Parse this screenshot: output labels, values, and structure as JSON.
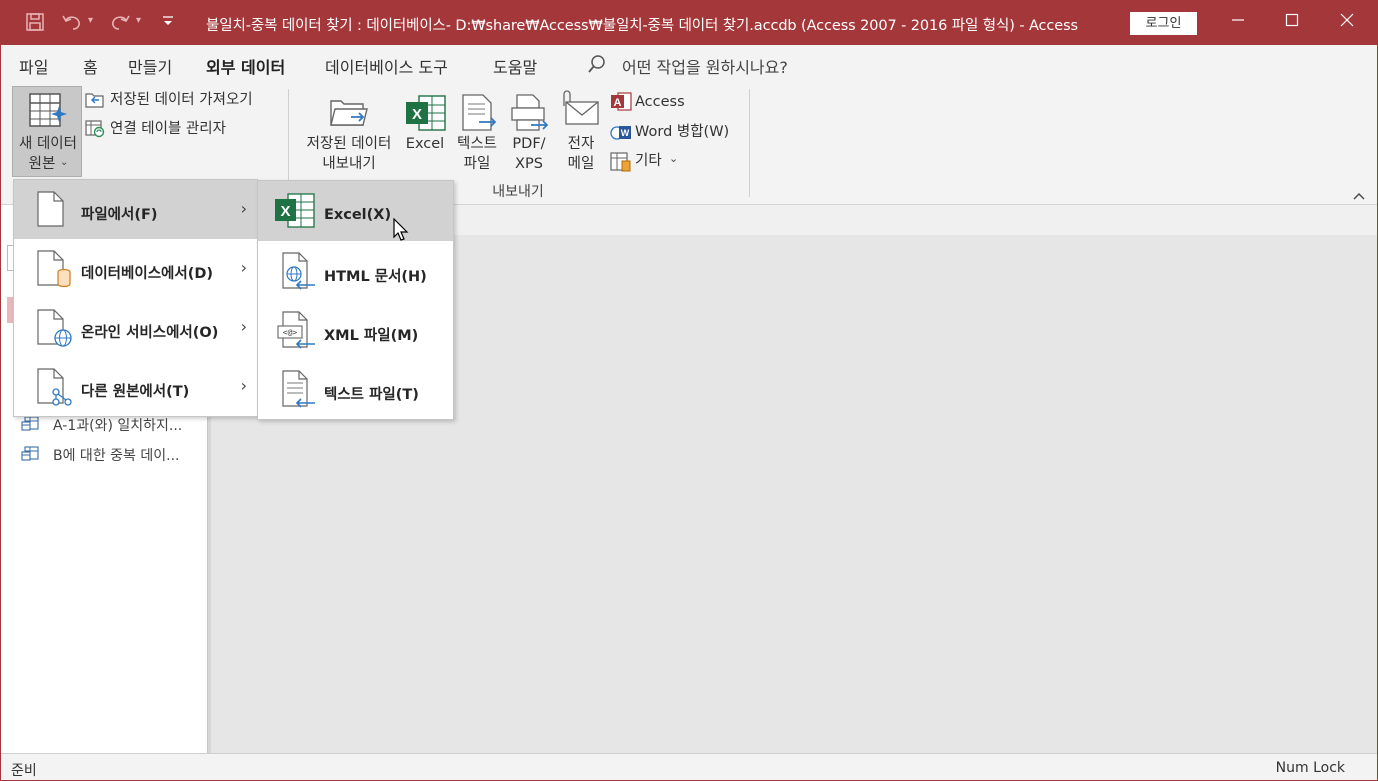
{
  "titlebar": {
    "title": "불일치-중복 데이터 찾기 : 데이터베이스- D:₩share₩Access₩불일치-중복 데이터 찾기.accdb (Access 2007 - 2016 파일 형식)  -  Access",
    "login": "로그인"
  },
  "tabs": [
    {
      "label": "파일"
    },
    {
      "label": "홈"
    },
    {
      "label": "만들기"
    },
    {
      "label": "외부 데이터"
    },
    {
      "label": "데이터베이스 도구"
    },
    {
      "label": "도움말"
    }
  ],
  "tell_me": "어떤 작업을 원하시나요?",
  "ribbon": {
    "new_source_line1": "새 데이터",
    "new_source_line2": "원본",
    "saved_imports": "저장된 데이터 가져오기",
    "linked_table_manager": "연결 테이블 관리자",
    "saved_exports_line1": "저장된 데이터",
    "saved_exports_line2": "내보내기",
    "excel": "Excel",
    "text_line1": "텍스트",
    "text_line2": "파일",
    "pdf_line1": "PDF/",
    "pdf_line2": "XPS",
    "email_line1": "전자",
    "email_line2": "메일",
    "access": "Access",
    "word_merge": "Word 병합(W)",
    "more": "기타",
    "export_group": "내보내기",
    "colors": {
      "access_red": "#a4373a",
      "excel_green": "#1f7244",
      "link_blue": "#2f78c4"
    }
  },
  "menu1": [
    {
      "label": "파일에서(F)",
      "icon": "file-icon"
    },
    {
      "label": "데이터베이스에서(D)",
      "icon": "database-file-icon"
    },
    {
      "label": "온라인 서비스에서(O)",
      "icon": "online-service-icon"
    },
    {
      "label": "다른 원본에서(T)",
      "icon": "other-source-icon"
    }
  ],
  "menu2": [
    {
      "label": "Excel(X)",
      "icon": "excel-icon"
    },
    {
      "label": "HTML 문서(H)",
      "icon": "html-document-icon"
    },
    {
      "label": "XML 파일(M)",
      "icon": "xml-file-icon"
    },
    {
      "label": "텍스트 파일(T)",
      "icon": "text-file-icon"
    }
  ],
  "nav": [
    {
      "label": "A-1과(와) 일치하지..."
    },
    {
      "label": "B에 대한 중복 데이..."
    }
  ],
  "status": {
    "left": "준비",
    "right": "Num Lock"
  }
}
